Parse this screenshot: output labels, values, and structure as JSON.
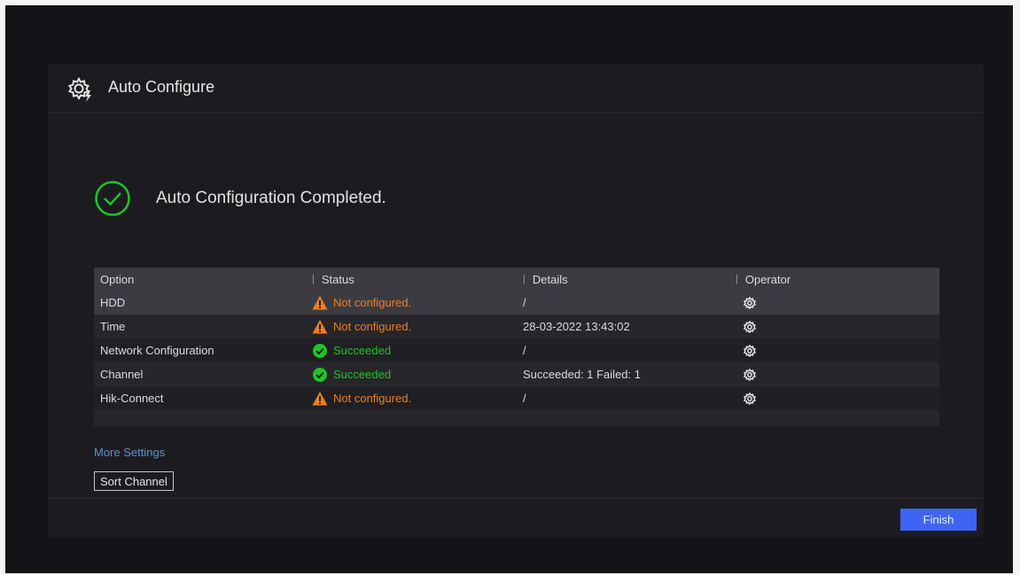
{
  "header": {
    "title": "Auto Configure",
    "icon": "gear-lightning-icon"
  },
  "result": {
    "message": "Auto Configuration Completed.",
    "icon": "check-circle-icon",
    "color": "#22c32a"
  },
  "table": {
    "columns": [
      "Option",
      "Status",
      "Details",
      "Operator"
    ],
    "rows": [
      {
        "option": "HDD",
        "status": "Not configured.",
        "status_type": "warning",
        "details": "/"
      },
      {
        "option": "Time",
        "status": "Not configured.",
        "status_type": "warning",
        "details": "28-03-2022 13:43:02"
      },
      {
        "option": "Network Configuration",
        "status": "Succeeded",
        "status_type": "success",
        "details": "/"
      },
      {
        "option": "Channel",
        "status": "Succeeded",
        "status_type": "success",
        "details": "Succeeded: 1 Failed: 1"
      },
      {
        "option": "Hik-Connect",
        "status": "Not configured.",
        "status_type": "warning",
        "details": "/"
      }
    ]
  },
  "links": {
    "more_settings": "More Settings"
  },
  "buttons": {
    "sort_channel": "Sort Channel",
    "finish": "Finish"
  },
  "colors": {
    "warning": "#f07d20",
    "success": "#22c32a",
    "accent": "#3e64f3"
  }
}
